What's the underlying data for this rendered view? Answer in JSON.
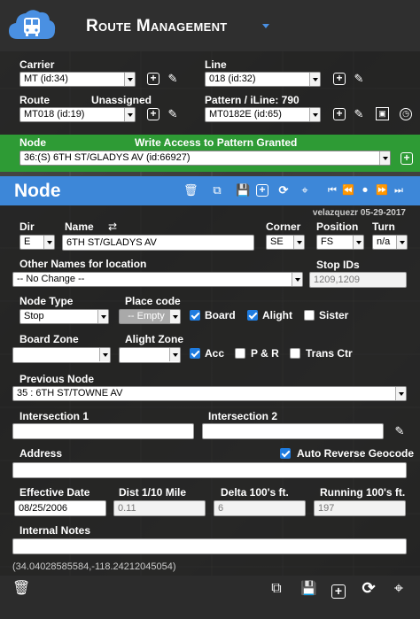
{
  "header": {
    "title": "Route Management"
  },
  "top": {
    "carrier_label": "Carrier",
    "carrier_value": "MT (id:34)",
    "line_label": "Line",
    "line_value": "018 (id:32)",
    "route_label": "Route",
    "unassigned_label": "Unassigned",
    "route_value": "MT018 (id:19)",
    "pattern_label": "Pattern / iLine: 790",
    "pattern_value": "MT0182E (id:65)"
  },
  "node_bar": {
    "label": "Node",
    "message": "Write Access to Pattern Granted",
    "value": "36:(S) 6TH ST/GLADYS AV (id:66927)"
  },
  "node_panel": {
    "title": "Node",
    "editor": "velazquezr 05-29-2017",
    "dir_label": "Dir",
    "dir_value": "E",
    "name_label": "Name",
    "name_value": "6TH ST/GLADYS AV",
    "corner_label": "Corner",
    "corner_value": "SE",
    "position_label": "Position",
    "position_value": "FS",
    "turn_label": "Turn",
    "turn_value": "n/a",
    "other_names_label": "Other Names for location",
    "other_names_value": "-- No Change --",
    "stop_ids_label": "Stop IDs",
    "stop_ids_value": "1209,1209",
    "node_type_label": "Node Type",
    "node_type_value": "Stop",
    "place_code_label": "Place code",
    "place_code_value": "-- Empty",
    "board_label": "Board",
    "board_checked": true,
    "alight_label": "Alight",
    "alight_checked": true,
    "sister_label": "Sister",
    "sister_checked": false,
    "board_zone_label": "Board Zone",
    "board_zone_value": "",
    "alight_zone_label": "Alight Zone",
    "alight_zone_value": "",
    "acc_label": "Acc",
    "acc_checked": true,
    "pr_label": "P & R",
    "pr_checked": false,
    "trans_label": "Trans Ctr",
    "trans_checked": false,
    "prev_node_label": "Previous Node",
    "prev_node_value": "35 : 6TH ST/TOWNE AV",
    "int1_label": "Intersection 1",
    "int1_value": "",
    "int2_label": "Intersection 2",
    "int2_value": "",
    "address_label": "Address",
    "address_value": "",
    "auto_rev_label": "Auto Reverse Geocode",
    "auto_rev_checked": true,
    "eff_date_label": "Effective Date",
    "eff_date_value": "08/25/2006",
    "dist_label": "Dist 1/10 Mile",
    "dist_value": "0.11",
    "delta_label": "Delta 100's ft.",
    "delta_value": "6",
    "running_label": "Running 100's ft.",
    "running_value": "197",
    "notes_label": "Internal Notes",
    "notes_value": "",
    "coords": "(34.04028585584,-118.24212045054)"
  },
  "colors": {
    "green_bar": "#2e9b35",
    "blue_bar": "#3d87d8",
    "logo": "#4a90e2"
  }
}
